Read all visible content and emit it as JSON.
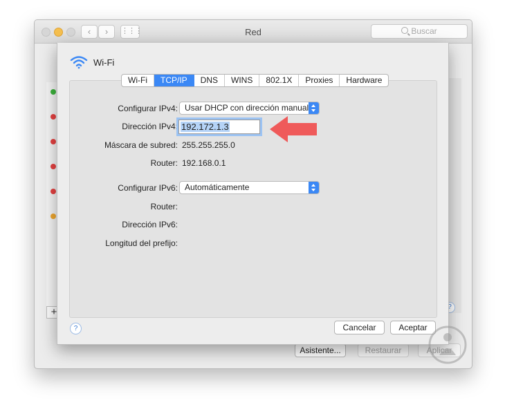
{
  "window": {
    "title": "Red",
    "search_placeholder": "Buscar",
    "nav_back": "‹",
    "nav_forward": "›",
    "nav_grid": "⋮⋮⋮"
  },
  "background": {
    "list_plus": "+",
    "help": "?",
    "status_dots": [
      "#3cb43c",
      "#e74242",
      "#e74242",
      "#e74242",
      "#e74242",
      "#f0a830"
    ],
    "buttons": {
      "assistant": "Asistente...",
      "restore": "Restaurar",
      "apply": "Aplicar"
    }
  },
  "sheet": {
    "interface": "Wi-Fi",
    "tabs": [
      "Wi-Fi",
      "TCP/IP",
      "DNS",
      "WINS",
      "802.1X",
      "Proxies",
      "Hardware"
    ],
    "active_tab": "TCP/IP",
    "ipv4": {
      "configure_label": "Configurar IPv4:",
      "configure_value": "Usar DHCP con dirección manual",
      "address_label": "Dirección IPv4:",
      "address_value": "192.172.1.3",
      "mask_label": "Máscara de subred:",
      "mask_value": "255.255.255.0",
      "router_label": "Router:",
      "router_value": "192.168.0.1"
    },
    "ipv6": {
      "configure_label": "Configurar IPv6:",
      "configure_value": "Automáticamente",
      "router_label": "Router:",
      "address_label": "Dirección IPv6:",
      "prefix_label": "Longitud del prefijo:"
    },
    "help": "?",
    "cancel_label": "Cancelar",
    "ok_label": "Aceptar"
  },
  "colors": {
    "accent": "#3b88f5",
    "annotation_arrow": "#ef5a5a"
  }
}
